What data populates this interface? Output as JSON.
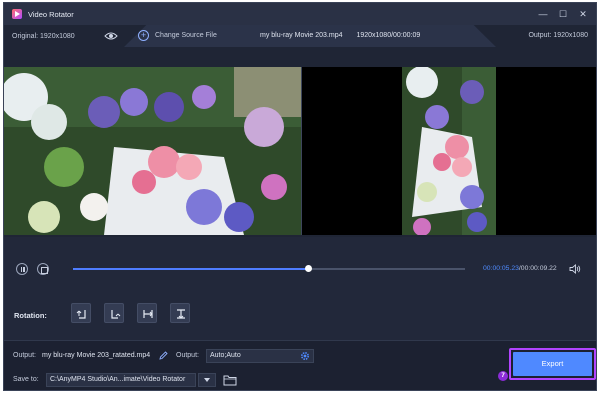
{
  "app": {
    "title": "Video Rotator",
    "logo_icon": "play-logo-icon"
  },
  "window_controls": {
    "minimize": "—",
    "maximize": "☐",
    "close": "✕"
  },
  "infobar": {
    "original": "Original: 1920x1080",
    "change_source": "Change Source File",
    "file_name": "my blu-ray Movie 203.mp4",
    "file_meta": "1920x1080/00:00:09",
    "output": "Output: 1920x1080"
  },
  "player": {
    "current_time": "00:00:05.23",
    "total_time": "/00:00:09.22",
    "progress_fraction": 0.6
  },
  "rotation": {
    "label": "Rotation:",
    "buttons": [
      "rotate-left-icon",
      "rotate-right-icon",
      "flip-horizontal-icon",
      "flip-vertical-icon"
    ]
  },
  "output_settings": {
    "output_label": "Output:",
    "output_filename": "my blu-ray Movie 203_ratated.mp4",
    "format_label": "Output:",
    "format_value": "Auto;Auto",
    "save_label": "Save to:",
    "save_path": "C:\\AnyMP4 Studio\\An...imate\\Video Rotator"
  },
  "export": {
    "label": "Export",
    "step": "7"
  },
  "colors": {
    "accent": "#4f89ff",
    "highlight": "#b244ff",
    "background": "#22283a"
  }
}
